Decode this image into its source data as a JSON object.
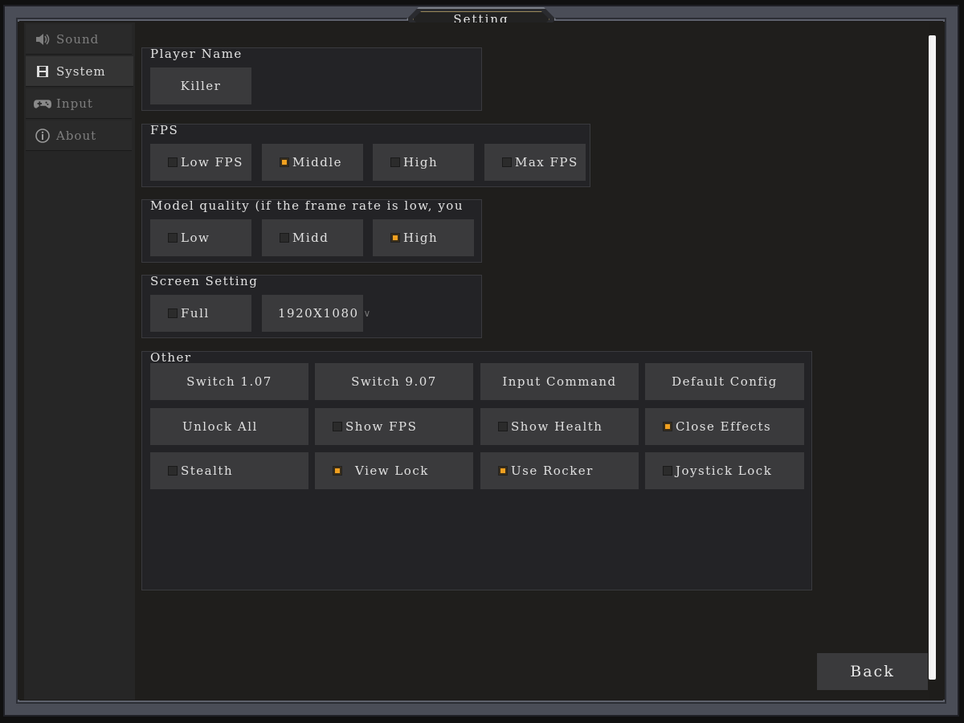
{
  "window": {
    "title": "Setting"
  },
  "sidebar": {
    "items": [
      {
        "label": "Sound",
        "icon": "speaker-icon",
        "active": false
      },
      {
        "label": "System",
        "icon": "floppy-disk-icon",
        "active": true
      },
      {
        "label": "Input",
        "icon": "gamepad-icon",
        "active": false
      },
      {
        "label": "About",
        "icon": "info-icon",
        "active": false
      }
    ]
  },
  "player_name": {
    "label": "Player Name",
    "value": "Killer"
  },
  "fps": {
    "label": "FPS",
    "options": [
      {
        "label": "Low FPS",
        "checked": false
      },
      {
        "label": "Middle",
        "checked": true
      },
      {
        "label": "High",
        "checked": false
      },
      {
        "label": "Max FPS",
        "checked": false
      }
    ]
  },
  "model_quality": {
    "label": "Model quality (if the frame rate is low, you",
    "options": [
      {
        "label": "Low",
        "checked": false
      },
      {
        "label": "Midd",
        "checked": false
      },
      {
        "label": "High",
        "checked": true
      }
    ]
  },
  "screen": {
    "label": "Screen Setting",
    "full": {
      "label": "Full",
      "checked": false
    },
    "resolution": "1920X1080"
  },
  "other": {
    "label": "Other",
    "buttons": [
      "Switch 1.07",
      "Switch 9.07",
      "Input Command",
      "Default Config",
      "Unlock All"
    ],
    "toggles": [
      {
        "label": "Show FPS",
        "checked": false
      },
      {
        "label": "Show Health",
        "checked": false
      },
      {
        "label": "Close Effects",
        "checked": true
      },
      {
        "label": "Stealth",
        "checked": false
      },
      {
        "label": "View Lock",
        "checked": true
      },
      {
        "label": "Use Rocker",
        "checked": true
      },
      {
        "label": "Joystick Lock",
        "checked": false
      }
    ]
  },
  "back_label": "Back",
  "colors": {
    "accent": "#f0a020",
    "panel": "#232326",
    "button": "#3a3a3c"
  }
}
